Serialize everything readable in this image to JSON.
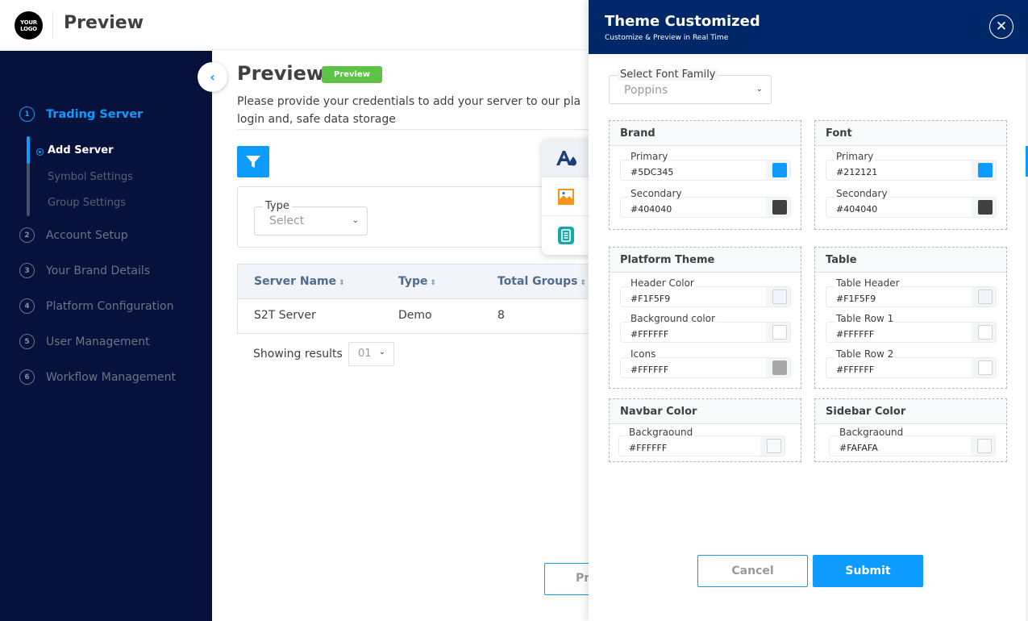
{
  "header": {
    "logo_text_line1": "YOUR",
    "logo_text_line2": "LOGO",
    "title": "Preview"
  },
  "sidebar": {
    "steps": [
      {
        "num": "1",
        "label": "Trading Server",
        "active": true
      },
      {
        "num": "2",
        "label": "Account Setup"
      },
      {
        "num": "3",
        "label": "Your Brand Details"
      },
      {
        "num": "4",
        "label": "Platform Configuration"
      },
      {
        "num": "5",
        "label": "User Management"
      },
      {
        "num": "6",
        "label": "Workflow Management"
      }
    ],
    "substeps": [
      {
        "label": "Add Server",
        "active": true
      },
      {
        "label": "Symbol Settings"
      },
      {
        "label": "Group Settings"
      }
    ],
    "collapse_icon": "chevron-left-icon"
  },
  "main": {
    "title": "Preview",
    "badge": "Preview",
    "description_line1": "Please provide your credentials to add your server to our pla",
    "description_line2": "login and, safe data storage",
    "filter": {
      "type_label": "Type",
      "type_value": "Select"
    },
    "table": {
      "columns": [
        "Server Name",
        "Type",
        "Total Groups"
      ],
      "rows": [
        [
          "S2T Server",
          "Demo",
          "8"
        ]
      ]
    },
    "pagination": {
      "showing_label": "Showing results",
      "per_page": "01"
    },
    "prev_button": "Pr"
  },
  "floating_tools": [
    "theme-color-icon",
    "image-icon",
    "document-icon"
  ],
  "theme_panel": {
    "title": "Theme Customized",
    "subtitle": "Customize & Preview in Real Time",
    "font_family": {
      "label": "Select Font Family",
      "value": "Poppins"
    },
    "groups": {
      "brand": {
        "title": "Brand",
        "fields": [
          {
            "label": "Primary",
            "value": "#5DC345",
            "swatch": "#0d9bff"
          },
          {
            "label": "Secondary",
            "value": "#404040",
            "swatch": "#404040"
          }
        ]
      },
      "font": {
        "title": "Font",
        "fields": [
          {
            "label": "Primary",
            "value": "#212121",
            "swatch": "#0d9bff"
          },
          {
            "label": "Secondary",
            "value": "#404040",
            "swatch": "#404040"
          }
        ]
      },
      "platform": {
        "title": "Platform Theme",
        "fields": [
          {
            "label": "Header Color",
            "value": "#F1F5F9",
            "swatch": "#f1f5f9"
          },
          {
            "label": "Background color",
            "value": "#FFFFFF",
            "swatch": "#ffffff"
          },
          {
            "label": "Icons",
            "value": "#FFFFFF",
            "swatch": "#a8a8a8"
          }
        ]
      },
      "table": {
        "title": "Table",
        "fields": [
          {
            "label": "Table Header",
            "value": "#F1F5F9",
            "swatch": "#f1f5f9"
          },
          {
            "label": "Table Row 1",
            "value": "#FFFFFF",
            "swatch": "#ffffff"
          },
          {
            "label": "Table Row 2",
            "value": "#FFFFFF",
            "swatch": "#ffffff"
          }
        ]
      },
      "navbar": {
        "title": "Navbar Color",
        "fields": [
          {
            "label": "Backgraound",
            "value": "#FFFFFF",
            "swatch": "#f8f9fa"
          }
        ]
      },
      "sidebar": {
        "title": "Sidebar Color",
        "fields": [
          {
            "label": "Backgraound",
            "value": "#FAFAFA",
            "swatch": "#fafafa"
          }
        ]
      }
    },
    "cancel_label": "Cancel",
    "submit_label": "Submit"
  },
  "colors": {
    "accent": "#0d9bff",
    "sidebar_bg": "#06123b",
    "panel_header_bg": "#002868",
    "badge_green": "#5dc345"
  }
}
